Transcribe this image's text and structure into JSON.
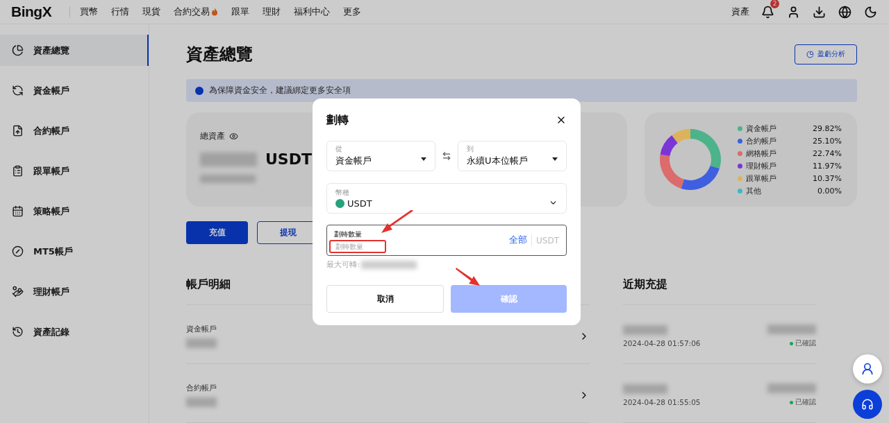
{
  "header": {
    "logo": "BingX",
    "nav": [
      {
        "label": "買幣"
      },
      {
        "label": "行情"
      },
      {
        "label": "現貨"
      },
      {
        "label": "合約交易",
        "hot": true
      },
      {
        "label": "跟單"
      },
      {
        "label": "理財"
      },
      {
        "label": "福利中心"
      },
      {
        "label": "更多"
      }
    ],
    "assets_link": "資產",
    "notification_count": "2"
  },
  "sidebar": {
    "items": [
      {
        "label": "資產總覽",
        "selected": true
      },
      {
        "label": "資金帳戶",
        "selected": false
      },
      {
        "label": "合約帳戶",
        "selected": false
      },
      {
        "label": "跟單帳戶",
        "selected": false
      },
      {
        "label": "策略帳戶",
        "selected": false
      },
      {
        "label": "MT5帳戶",
        "selected": false
      },
      {
        "label": "理財帳戶",
        "selected": false
      },
      {
        "label": "資產記錄",
        "selected": false
      }
    ]
  },
  "page": {
    "title": "資產總覽",
    "pnl_button": "盈虧分析",
    "banner": "為保障資金安全，建議綁定更多安全項"
  },
  "balance": {
    "label": "總資產",
    "currency": "USDT",
    "actions": [
      "充值",
      "提現"
    ]
  },
  "distribution": {
    "chart_data": {
      "type": "donut",
      "categories": [
        "資金帳戶",
        "合約帳戶",
        "網格帳戶",
        "理財帳戶",
        "跟單帳戶",
        "其他"
      ],
      "values": [
        29.82,
        25.1,
        22.74,
        11.97,
        10.37,
        0
      ]
    },
    "legend": [
      {
        "value": "29.82%",
        "color": "#4db38a"
      },
      {
        "value": "25.10%",
        "color": "#3f5fe0"
      },
      {
        "value": "22.74%",
        "color": "#dc6b6b"
      },
      {
        "value": "11.97%",
        "color": "#7b35d6"
      },
      {
        "value": "10.37%",
        "color": "#dcb35a"
      },
      {
        "value": "0.00%",
        "color": "#3ab8c4"
      }
    ]
  },
  "accounts": {
    "title": "帳戶明細",
    "rows": [
      {
        "name": "資金帳戶"
      },
      {
        "name": "合約帳戶"
      }
    ]
  },
  "recent": {
    "title": "近期充提",
    "rows": [
      {
        "time": "2024-04-28 01:57:06",
        "status": "已確認"
      },
      {
        "time": "2024-04-28 01:55:05",
        "status": "已確認"
      }
    ]
  },
  "modal": {
    "title": "劃轉",
    "from": {
      "label": "從",
      "value": "資金帳戶"
    },
    "to": {
      "label": "到",
      "value": "永續U本位帳戶"
    },
    "coin": {
      "label": "幣種",
      "value": "USDT"
    },
    "amount": {
      "label": "劃轉數量",
      "placeholder": "劃轉數量",
      "all": "全部",
      "unit": "USDT"
    },
    "max_label": "最大可轉:",
    "cancel": "取消",
    "confirm": {
      "label": "確認",
      "disabled": true
    }
  }
}
